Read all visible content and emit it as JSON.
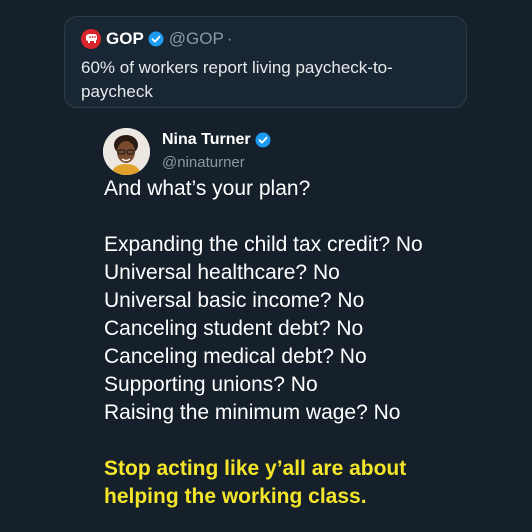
{
  "quoted_tweet": {
    "account_name": "GOP",
    "handle": "@GOP",
    "separator": "·",
    "text": "60% of workers report living paycheck-to-paycheck"
  },
  "tweet": {
    "author_name": "Nina Turner",
    "author_handle": "@ninaturner",
    "opening": "And what’s your plan?",
    "questions": [
      "Expanding the child tax credit? No",
      "Universal healthcare? No",
      "Universal basic income? No",
      "Canceling student debt? No",
      "Canceling medical debt? No",
      "Supporting unions? No",
      "Raising the minimum wage? No"
    ],
    "closing_lines": [
      "Stop acting like y’all are about",
      "helping the working class."
    ]
  },
  "colors": {
    "background": "#15202b",
    "verified_badge": "#1d9bf0",
    "highlight_text": "#f5e52a",
    "gop_logo": "#d8262b"
  },
  "icons": {
    "gop_logo": "elephant-icon",
    "verified": "verified-badge-icon"
  }
}
